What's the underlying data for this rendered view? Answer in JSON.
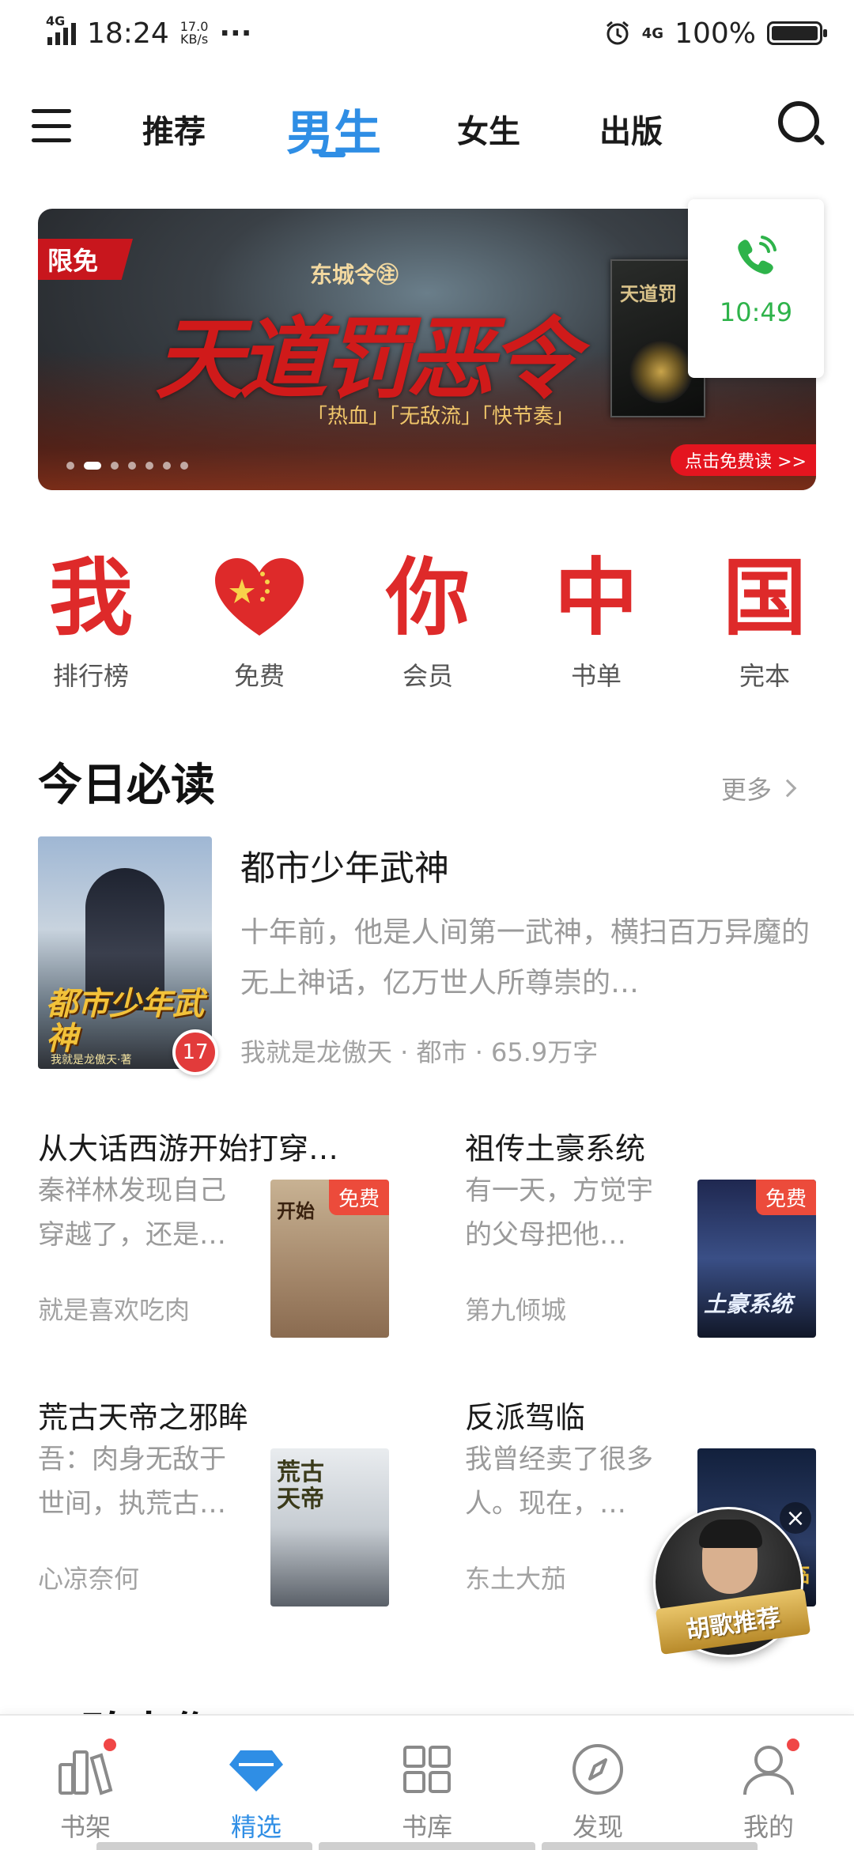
{
  "status_bar": {
    "network": "4G",
    "time": "18:24",
    "speed_value": "17.0",
    "speed_unit": "KB/s",
    "more": "···",
    "network_right": "4G",
    "battery": "100%"
  },
  "top_nav": {
    "tabs": [
      "推荐",
      "男生",
      "女生",
      "出版"
    ],
    "active_tab": "男生",
    "active_color": "#2f8ee5"
  },
  "banner": {
    "tag": "限免",
    "author": "东城令㊟",
    "title": "天道罚恶令",
    "genre_tags": "「热血」「无敌流」「快节奏」",
    "cover_title": "天道罚",
    "cta": "点击免费读 >>",
    "active_dot": 1,
    "dot_count": 7
  },
  "call_widget": {
    "time": "10:49",
    "icon": "phone-icon",
    "color": "#2eb34a"
  },
  "categories": [
    {
      "glyph": "我",
      "label": "排行榜"
    },
    {
      "glyph": "♥",
      "label": "免费"
    },
    {
      "glyph": "你",
      "label": "会员"
    },
    {
      "glyph": "中",
      "label": "书单"
    },
    {
      "glyph": "国",
      "label": "完本"
    }
  ],
  "today_section": {
    "title": "今日必读",
    "more": "更多"
  },
  "featured_book": {
    "title": "都市少年武神",
    "desc": "十年前，他是人间第一武神，横扫百万异魔的无上神话，亿万世人所尊崇的…",
    "meta": "我就是龙傲天 · 都市 · 65.9万字",
    "cover_text": "都市少年武神",
    "cover_author": "我就是龙傲天·著",
    "rank": "17"
  },
  "books": [
    {
      "title": "从大话西游开始打穿…",
      "desc": "秦祥林发现自己穿越了，还是…",
      "author": "就是喜欢吃肉",
      "free_tag": "免费",
      "cover_text": "开始"
    },
    {
      "title": "祖传土豪系统",
      "desc": "有一天，方觉宇的父母把他…",
      "author": "第九倾城",
      "free_tag": "免费",
      "cover_text": "土豪系统"
    },
    {
      "title": "荒古天帝之邪眸",
      "desc": "吾：肉身无敌于世间，执荒古…",
      "author": "心凉奈何",
      "free_tag": "",
      "cover_text": "荒古天帝"
    },
    {
      "title": "反派驾临",
      "desc": "我曾经卖了很多人。现在，…",
      "author": "东土大茄",
      "free_tag": "",
      "cover_text": "驾临"
    }
  ],
  "promo": {
    "label": "胡歌推荐",
    "close": "×"
  },
  "next_section": {
    "title": "口碑大作"
  },
  "bottom_nav": {
    "items": [
      {
        "label": "书架",
        "icon": "bookshelf-icon",
        "badge": true
      },
      {
        "label": "精选",
        "icon": "diamond-icon",
        "badge": false
      },
      {
        "label": "书库",
        "icon": "grid-icon",
        "badge": false
      },
      {
        "label": "发现",
        "icon": "compass-icon",
        "badge": false
      },
      {
        "label": "我的",
        "icon": "profile-icon",
        "badge": true
      }
    ],
    "active": "精选"
  }
}
